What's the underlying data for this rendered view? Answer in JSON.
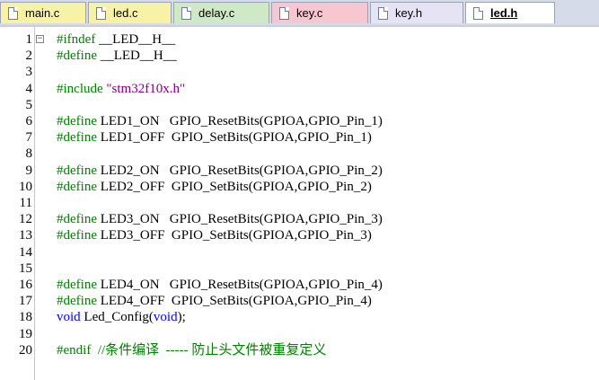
{
  "tabs": [
    {
      "label": "main.c",
      "color": "#f7f2a6",
      "active": false
    },
    {
      "label": "led.c",
      "color": "#f7f2a6",
      "active": false
    },
    {
      "label": "delay.c",
      "color": "#cfe8c5",
      "active": false
    },
    {
      "label": "key.c",
      "color": "#f6c7cf",
      "active": false
    },
    {
      "label": "key.h",
      "color": "#e6e4f4",
      "active": false
    },
    {
      "label": "led.h",
      "color": "#ffffff",
      "active": true
    }
  ],
  "lines": [
    {
      "n": "1",
      "html": "<span class='pp'>#ifndef</span> __LED__H__",
      "fold": true
    },
    {
      "n": "2",
      "html": "<span class='pp'>#define</span> __LED__H__"
    },
    {
      "n": "3",
      "html": ""
    },
    {
      "n": "4",
      "html": "<span class='pp'>#include</span> <span class='str'>\"stm32f10x.h\"</span>"
    },
    {
      "n": "5",
      "html": ""
    },
    {
      "n": "6",
      "html": "<span class='pp'>#define</span> LED1_ON   GPIO_ResetBits(GPIOA,GPIO_Pin_1)"
    },
    {
      "n": "7",
      "html": "<span class='pp'>#define</span> LED1_OFF  GPIO_SetBits(GPIOA,GPIO_Pin_1)"
    },
    {
      "n": "8",
      "html": ""
    },
    {
      "n": "9",
      "html": "<span class='pp'>#define</span> LED2_ON   GPIO_ResetBits(GPIOA,GPIO_Pin_2)"
    },
    {
      "n": "10",
      "html": "<span class='pp'>#define</span> LED2_OFF  GPIO_SetBits(GPIOA,GPIO_Pin_2)"
    },
    {
      "n": "11",
      "html": ""
    },
    {
      "n": "12",
      "html": "<span class='pp'>#define</span> LED3_ON   GPIO_ResetBits(GPIOA,GPIO_Pin_3)"
    },
    {
      "n": "13",
      "html": "<span class='pp'>#define</span> LED3_OFF  GPIO_SetBits(GPIOA,GPIO_Pin_3)"
    },
    {
      "n": "14",
      "html": ""
    },
    {
      "n": "15",
      "html": ""
    },
    {
      "n": "16",
      "html": "<span class='pp'>#define</span> LED4_ON   GPIO_ResetBits(GPIOA,GPIO_Pin_4)"
    },
    {
      "n": "17",
      "html": "<span class='pp'>#define</span> LED4_OFF  GPIO_SetBits(GPIOA,GPIO_Pin_4)"
    },
    {
      "n": "18",
      "html": "<span class='kw'>void</span> Led_Config(<span class='kw'>void</span>);"
    },
    {
      "n": "19",
      "html": ""
    },
    {
      "n": "20",
      "html": "<span class='pp'>#endif</span>  <span class='cm'>//条件编译  ----- 防止头文件被重复定义</span>"
    }
  ]
}
